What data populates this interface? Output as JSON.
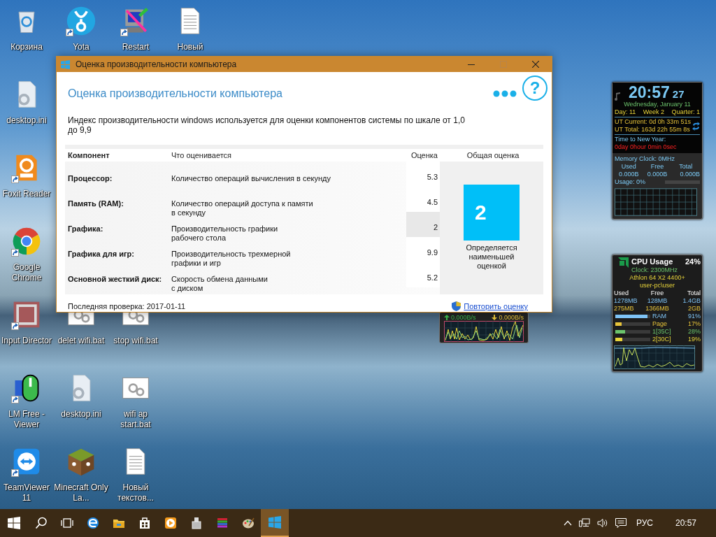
{
  "desktop_icons": [
    {
      "label": "Корзина",
      "kind": "recycle",
      "shortcut": false
    },
    {
      "label": "Yota",
      "kind": "yota",
      "shortcut": true
    },
    {
      "label": "Restart",
      "kind": "restart",
      "shortcut": true
    },
    {
      "label": "Новый",
      "kind": "textdoc",
      "shortcut": false
    },
    {
      "label": "desktop.ini",
      "kind": "ini",
      "shortcut": false
    },
    {
      "label": "Foxit Reader",
      "kind": "pdf",
      "shortcut": true
    },
    {
      "label": "Google Chrome",
      "kind": "chrome",
      "shortcut": true
    },
    {
      "label": "Input Director",
      "kind": "id",
      "shortcut": true
    },
    {
      "label": "delet wifi.bat",
      "kind": "bat",
      "shortcut": false
    },
    {
      "label": "stop wifi.bat",
      "kind": "bat",
      "shortcut": false
    },
    {
      "label": "LM Free - Viewer",
      "kind": "mouse",
      "shortcut": true
    },
    {
      "label": "desktop.ini",
      "kind": "ini",
      "shortcut": false
    },
    {
      "label": "wifi ap start.bat",
      "kind": "bat",
      "shortcut": false
    },
    {
      "label": "TeamViewer 11",
      "kind": "teamviewer",
      "shortcut": true
    },
    {
      "label": "Minecraft Only La...",
      "kind": "minecraft",
      "shortcut": false
    },
    {
      "label": "Новый текстов...",
      "kind": "textdoc",
      "shortcut": false
    }
  ],
  "window": {
    "title": "Оценка производительности компьютера",
    "heading": "Оценка производительности компьютера",
    "help": "?",
    "description": "Индекс производительности windows используется для оценки компонентов системы по шкале от 1,0\nдо 9,9",
    "columns": [
      "Компонент",
      "Что оценивается",
      "Оценка",
      "Общая оценка"
    ],
    "rows": [
      {
        "component": "Процессор:",
        "measures": "Количество операций вычисления в секунду",
        "score": "5.3",
        "lowest": false
      },
      {
        "component": "Память (RAM):",
        "measures": "Количество операций доступа к памяти\nв секунду",
        "score": "4.5",
        "lowest": false
      },
      {
        "component": "Графика:",
        "measures": "Производительность графики\nрабочего стола",
        "score": "2",
        "lowest": true
      },
      {
        "component": "Графика для игр:",
        "measures": "Производительность трехмерной\nграфики и игр",
        "score": "9.9",
        "lowest": false
      },
      {
        "component": "Основной жесткий диск:",
        "measures": "Скорость обмена данными\nс диском",
        "score": "5.2",
        "lowest": false
      }
    ],
    "overall": {
      "score": "2",
      "caption": "Определяется\nнаименьшей\nоценкой"
    },
    "last_check": "Последняя проверка: 2017-01-11",
    "rerun_link": "Повторить оценку"
  },
  "clock_gadget": {
    "time": "20:57",
    "seconds": "27",
    "date": "Wednesday, January 11",
    "day": "Day: 11",
    "week": "Week 2",
    "quarter": "Quarter: 1",
    "ut_current": "UT Current: 0d 0h 33m 51s",
    "ut_total": "UT Total: 163d 22h 55m 8s",
    "ny_label": "Time to New Year:",
    "ny_value": "0day 0hour 0min 0sec",
    "memory_clock": "Memory Clock: 0MHz",
    "headers": [
      "Used",
      "Free",
      "Total"
    ],
    "values": [
      "0.000B",
      "0.000B",
      "0.000B"
    ],
    "usage": "Usage: 0%"
  },
  "cpu_gadget": {
    "title": "CPU Usage",
    "percent": "24%",
    "clock": "Clock: 2300MHz",
    "model": "Athlon 64 X2 4400+",
    "user": "user-pc\\user",
    "headers": [
      "Used",
      "Free",
      "Total"
    ],
    "mem_rows": [
      [
        "1278MB",
        "128MB",
        "1.4GB"
      ],
      [
        "275MB",
        "1366MB",
        "2GB"
      ]
    ],
    "meters": [
      {
        "label": "RAM",
        "value": "91%",
        "level": 0.91,
        "color": "#7ec3f5"
      },
      {
        "label": "Page",
        "value": "17%",
        "level": 0.17,
        "color": "#e8c43a"
      },
      {
        "label": "1[35C]",
        "value": "28%",
        "level": 0.28,
        "color": "#6cc46c"
      },
      {
        "label": "2[30C]",
        "value": "19%",
        "level": 0.19,
        "color": "#e8d43a"
      }
    ]
  },
  "network_gadget": {
    "upload": "0.000B/s",
    "download": "0.000B/s"
  },
  "taskbar": {
    "language": "РУС",
    "time": "20:57"
  }
}
